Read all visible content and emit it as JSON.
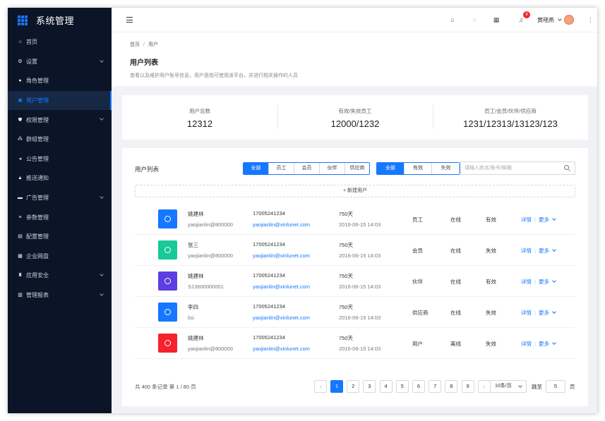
{
  "app": {
    "title": "系统管理"
  },
  "sidebar": {
    "items": [
      {
        "label": "首页",
        "icon": "home-icon",
        "glyph": "⌂",
        "expandable": false
      },
      {
        "label": "设置",
        "icon": "gear-icon",
        "glyph": "⚙",
        "expandable": true
      },
      {
        "label": "角色管理",
        "icon": "user-circle-icon",
        "glyph": "●",
        "expandable": false
      },
      {
        "label": "用户管理",
        "icon": "user-icon",
        "glyph": "▣",
        "expandable": false,
        "active": true
      },
      {
        "label": "权限管理",
        "icon": "shield-icon",
        "glyph": "⛊",
        "expandable": true
      },
      {
        "label": "群组管理",
        "icon": "group-icon",
        "glyph": "⁂",
        "expandable": false
      },
      {
        "label": "公告管理",
        "icon": "megaphone-icon",
        "glyph": "◂",
        "expandable": false
      },
      {
        "label": "推送通知",
        "icon": "bell-icon",
        "glyph": "▲",
        "expandable": false
      },
      {
        "label": "广告管理",
        "icon": "ad-icon",
        "glyph": "▬",
        "expandable": true
      },
      {
        "label": "参数管理",
        "icon": "sliders-icon",
        "glyph": "≡",
        "expandable": false
      },
      {
        "label": "配置管理",
        "icon": "config-icon",
        "glyph": "▤",
        "expandable": false
      },
      {
        "label": "企业网盘",
        "icon": "grid-icon",
        "glyph": "▦",
        "expandable": false
      },
      {
        "label": "应用安全",
        "icon": "lock-icon",
        "glyph": "♜",
        "expandable": true
      },
      {
        "label": "管理报表",
        "icon": "report-icon",
        "glyph": "▥",
        "expandable": true
      }
    ]
  },
  "header": {
    "notification_count": "8",
    "username": "黄晓燕",
    "icons": [
      "home-icon",
      "headset-icon",
      "apps-icon",
      "bell-icon",
      "more-icon"
    ]
  },
  "page": {
    "breadcrumb": [
      "首页",
      "用户"
    ],
    "title": "用户列表",
    "description": "查看以及维护用户账号信息，用户是指可使用该平台，并进行相关操作的人员"
  },
  "stats": [
    {
      "label": "用户总数",
      "value": "12312"
    },
    {
      "label": "有效/失效员工",
      "value": "12000/1232"
    },
    {
      "label": "员工/会员/伙伴/供应商",
      "value": "1231/12313/13123/123"
    }
  ],
  "list": {
    "title": "用户列表",
    "type_filter": [
      "全部",
      "员工",
      "会员",
      "伙伴",
      "供应商"
    ],
    "type_selected": 0,
    "status_filter": [
      "全部",
      "有效",
      "失效"
    ],
    "status_selected": 0,
    "search_placeholder": "请输入姓名/账号/邮箱",
    "add_label": "+ 新建用户",
    "ops": {
      "detail": "详情",
      "more": "更多"
    },
    "rows": [
      {
        "name": "姚建林",
        "account": "yaojianlin@800000",
        "phone": "17005241234",
        "email": "yaojianlin@xinlunet.com",
        "duration": "750天",
        "time": "2016-06-15  14:03",
        "type": "员工",
        "online": "在线",
        "status": "有效",
        "color": "#1677ff"
      },
      {
        "name": "张三",
        "account": "yaojianlin@800000",
        "phone": "17005241234",
        "email": "yaojianlin@xinlunet.com",
        "duration": "750天",
        "time": "2016-06-15  14:03",
        "type": "会员",
        "online": "在线",
        "status": "失效",
        "color": "#19c998"
      },
      {
        "name": "姚建林",
        "account": "S13600000001",
        "phone": "17005241234",
        "email": "yaojianlin@xinlunet.com",
        "duration": "750天",
        "time": "2016-06-15  14:03",
        "type": "伙伴",
        "online": "在线",
        "status": "有效",
        "color": "#5b3fe0"
      },
      {
        "name": "李四",
        "account": "lisi",
        "phone": "17005241234",
        "email": "yaojianlin@xinlunet.com",
        "duration": "750天",
        "time": "2016-06-15  14:03",
        "type": "供应商",
        "online": "在线",
        "status": "失效",
        "color": "#1677ff"
      },
      {
        "name": "姚建林",
        "account": "yaojianlin@800000",
        "phone": "17005241234",
        "email": "yaojianlin@xinlunet.com",
        "duration": "750天",
        "time": "2016-06-15  14:03",
        "type": "用户",
        "online": "离线",
        "status": "失效",
        "color": "#f5222d"
      }
    ]
  },
  "pagination": {
    "summary": "共 400 条记录 第 1 / 80 页",
    "pages": [
      "1",
      "2",
      "3",
      "4",
      "5",
      "6",
      "7",
      "8",
      "9"
    ],
    "current": "1",
    "page_size": "10条/页",
    "jump_label": "跳至",
    "jump_value": "5",
    "unit": "页"
  }
}
